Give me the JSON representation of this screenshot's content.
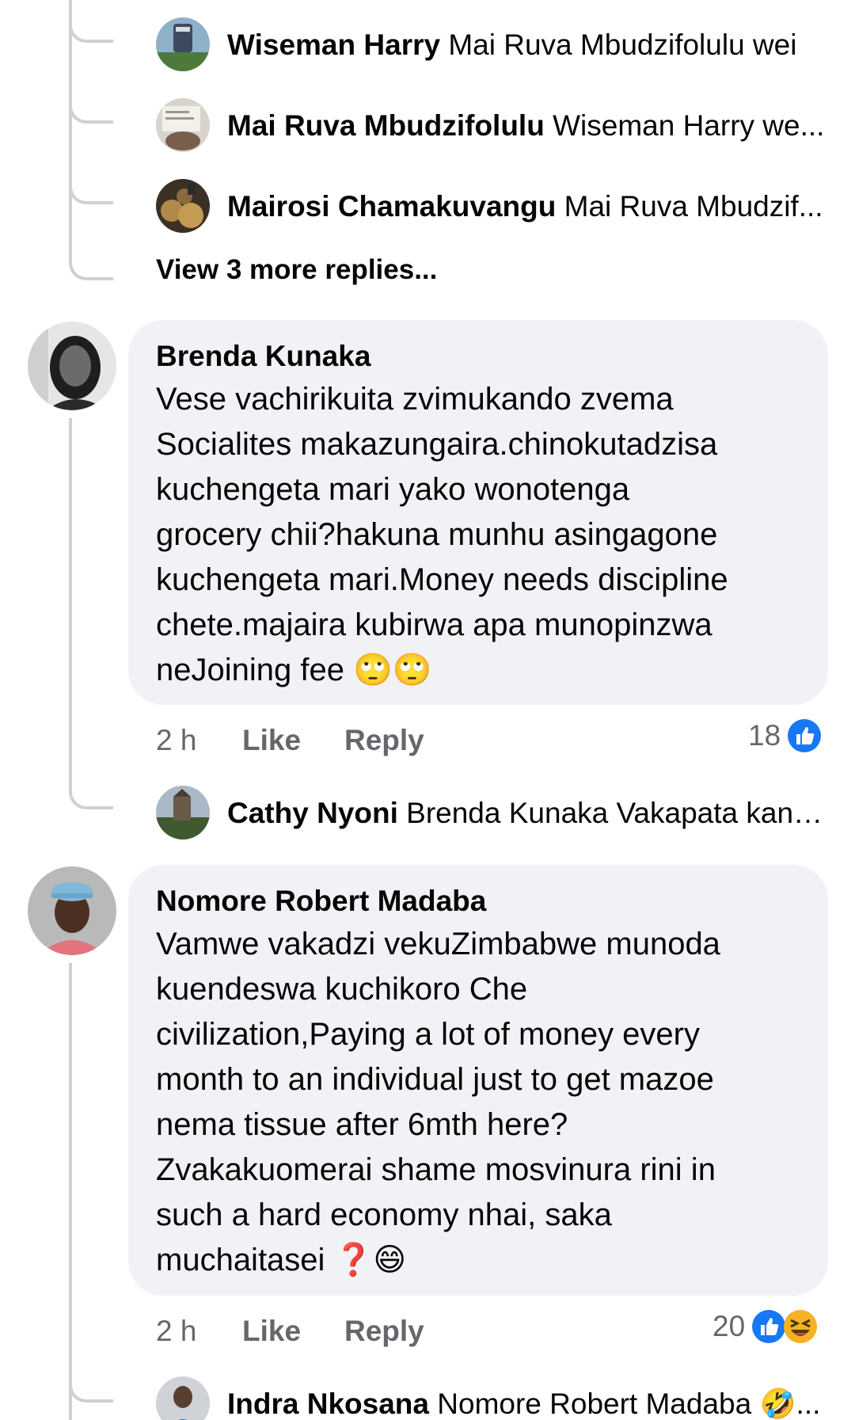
{
  "thread1": {
    "replies": [
      {
        "author": "Wiseman Harry",
        "text": "Mai Ruva Mbudzifolulu wei"
      },
      {
        "author": "Mai Ruva Mbudzifolulu",
        "text": "Wiseman Harry we..."
      },
      {
        "author": "Mairosi Chamakuvangu",
        "text": "Mai Ruva Mbudzif..."
      }
    ],
    "more_replies": "View 3 more replies..."
  },
  "comments": [
    {
      "author": "Brenda Kunaka",
      "body": "Vese vachirikuita zvimukando zvema\nSocialites  makazungaira.chinokutadzisa\nkuchengeta mari yako wonotenga\ngrocery chii?hakuna munhu asingagone\nkuchengeta mari.Money needs discipline\nchete.majaira kubirwa apa munopinzwa\nneJoining fee 🙄🙄",
      "time": "2 h",
      "like": "Like",
      "reply": "Reply",
      "reaction_count": "18",
      "reactions": [
        "like-icon"
      ],
      "replies": [
        {
          "author": "Cathy Nyoni",
          "text": "Brenda Kunaka Vakapata kani...."
        }
      ]
    },
    {
      "author": "Nomore Robert Madaba",
      "body": "Vamwe vakadzi vekuZimbabwe munoda\nkuendeswa kuchikoro Che\ncivilization,Paying a lot of money every\nmonth to an individual just to get mazoe\nnema tissue after 6mth here?\nZvakakuomerai shame mosvinura rini in\nsuch a hard economy nhai, saka\nmuchaitasei ❓😄",
      "time": "2 h",
      "like": "Like",
      "reply": "Reply",
      "reaction_count": "20",
      "reactions": [
        "like-icon",
        "laughing-icon"
      ],
      "replies": [
        {
          "author": "Indra Nkosana",
          "text": "Nomore Robert Madaba 🤣..."
        }
      ]
    }
  ],
  "colors": {
    "bubble": "#f0f2f5",
    "thread_line": "#ced0d4",
    "meta_text": "#65676b",
    "like_blue": "#1877f2",
    "haha_yellow": "#f7b125"
  }
}
